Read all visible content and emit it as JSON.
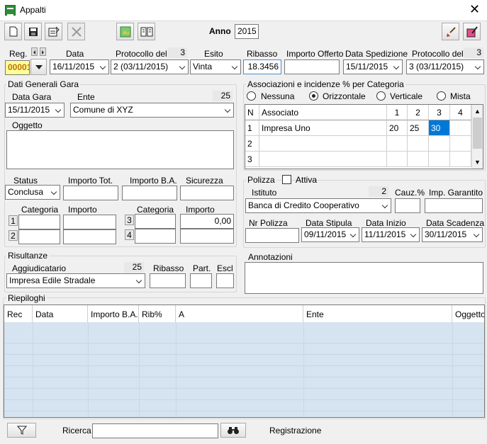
{
  "window": {
    "title": "Appalti",
    "close_glyph": "✕"
  },
  "toolbar": {
    "anno_label": "Anno",
    "anno_value": "2015"
  },
  "header": {
    "reg_label": "Reg.",
    "reg_value": "00001",
    "data_label": "Data",
    "data_value": "16/11/2015",
    "protocollo_label": "Protocollo del",
    "protocollo_count": "3",
    "protocollo_value": "2 (03/11/2015)",
    "esito_label": "Esito",
    "esito_value": "Vinta",
    "ribasso_label": "Ribasso",
    "ribasso_value": "18.3456",
    "importo_offerto_label": "Importo Offerto",
    "importo_offerto_value": "",
    "data_spedizione_label": "Data Spedizione",
    "data_spedizione_value": "15/11/2015",
    "protocollo2_label": "Protocollo del",
    "protocollo2_count": "3",
    "protocollo2_value": "3 (03/11/2015)"
  },
  "dati_gara": {
    "title": "Dati Generali Gara",
    "data_gara_label": "Data Gara",
    "data_gara_value": "15/11/2015",
    "ente_label": "Ente",
    "ente_count": "25",
    "ente_value": "Comune di XYZ",
    "oggetto_label": "Oggetto",
    "oggetto_value": "",
    "status_label": "Status",
    "status_value": "Conclusa",
    "importo_tot_label": "Importo Tot.",
    "importo_ba_label": "Importo B.A.",
    "sicurezza_label": "Sicurezza",
    "categoria_label": "Categoria",
    "importo_label": "Importo",
    "row1_num": "1",
    "row2_num": "2",
    "row3_num": "3",
    "row4_num": "4",
    "importo3_value": "0,00"
  },
  "risultanze": {
    "title": "Risultanze",
    "aggiudicatario_label": "Aggiudicatario",
    "aggiudicatario_count": "25",
    "aggiudicatario_value": "Impresa Edile Stradale",
    "ribasso_label": "Ribasso",
    "part_label": "Part.",
    "escl_label": "Escl"
  },
  "associazioni": {
    "title": "Associazioni e incidenze % per Categoria",
    "options": [
      "Nessuna",
      "Orizzontale",
      "Verticale",
      "Mista"
    ],
    "selected": "Orizzontale",
    "columns": [
      "N",
      "Associato",
      "1",
      "2",
      "3",
      "4"
    ],
    "rows": [
      {
        "n": "1",
        "associato": "Impresa Uno",
        "c1": "20",
        "c2": "25",
        "c3": "30",
        "c4": ""
      },
      {
        "n": "2",
        "associato": "",
        "c1": "",
        "c2": "",
        "c3": "",
        "c4": ""
      },
      {
        "n": "3",
        "associato": "",
        "c1": "",
        "c2": "",
        "c3": "",
        "c4": ""
      }
    ],
    "selection_color": "#0078d7"
  },
  "polizza": {
    "title": "Polizza",
    "attiva_label": "Attiva",
    "istituto_label": "Istituto",
    "istituto_count": "2",
    "istituto_value": "Banca di Credito Cooperativo",
    "cauz_label": "Cauz.%",
    "imp_garantito_label": "Imp. Garantito",
    "nr_polizza_label": "Nr Polizza",
    "data_stipula_label": "Data Stipula",
    "data_stipula_value": "09/11/2015",
    "data_inizio_label": "Data Inizio",
    "data_inizio_value": "11/11/2015",
    "data_scadenza_label": "Data Scadenza",
    "data_scadenza_value": "30/11/2015"
  },
  "annotazioni": {
    "title": "Annotazioni"
  },
  "riepiloghi": {
    "title": "Riepiloghi",
    "columns": [
      "Rec",
      "Data",
      "Importo B.A.",
      "Rib%",
      "A",
      "Ente",
      "Oggetto"
    ],
    "stripe_color": "#d6e4f1"
  },
  "footer": {
    "ricerca_label": "Ricerca",
    "registrazione_label": "Registrazione"
  }
}
